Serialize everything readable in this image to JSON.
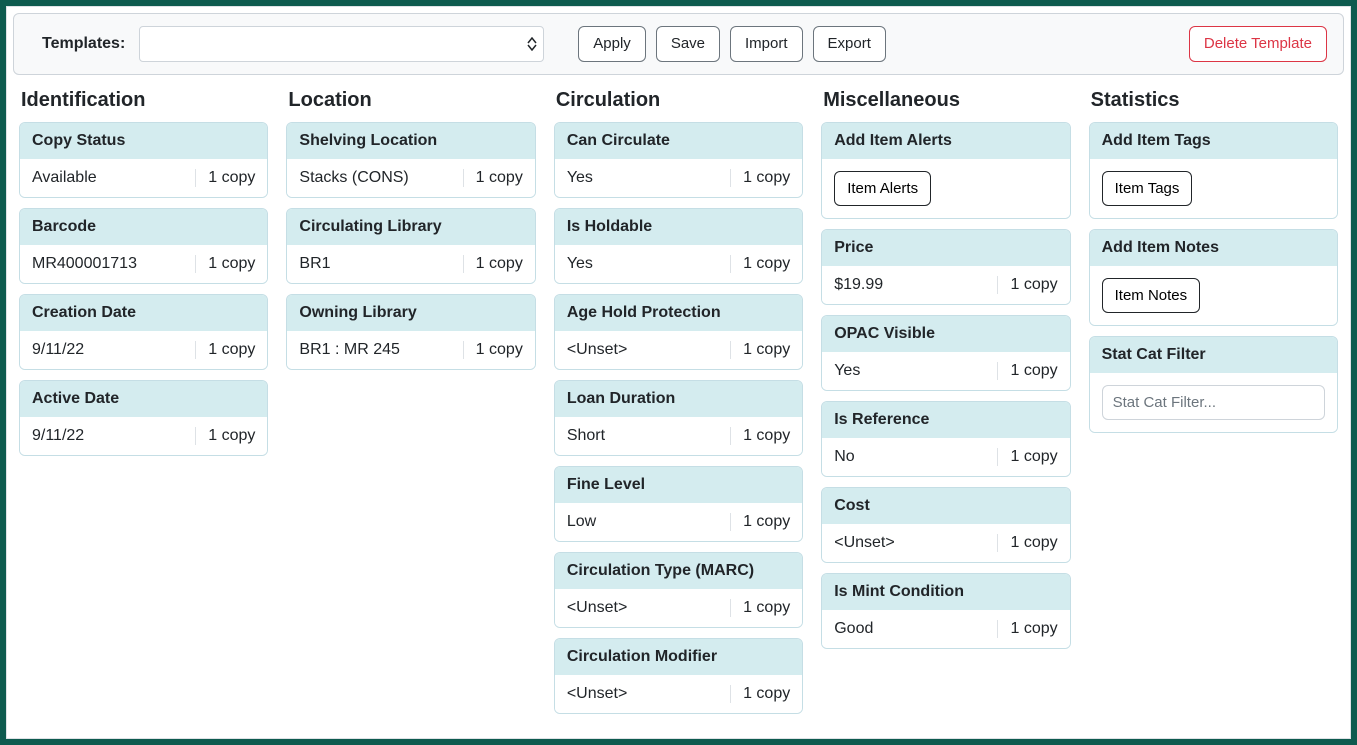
{
  "toolbar": {
    "templates_label": "Templates:",
    "apply": "Apply",
    "save": "Save",
    "import": "Import",
    "export": "Export",
    "delete_template": "Delete Template"
  },
  "columns": {
    "identification": {
      "title": "Identification",
      "fields": [
        {
          "label": "Copy Status",
          "value": "Available",
          "count": "1 copy"
        },
        {
          "label": "Barcode",
          "value": "MR400001713",
          "count": "1 copy"
        },
        {
          "label": "Creation Date",
          "value": "9/11/22",
          "count": "1 copy"
        },
        {
          "label": "Active Date",
          "value": "9/11/22",
          "count": "1 copy"
        }
      ]
    },
    "location": {
      "title": "Location",
      "fields": [
        {
          "label": "Shelving Location",
          "value": "Stacks (CONS)",
          "count": "1 copy"
        },
        {
          "label": "Circulating Library",
          "value": "BR1",
          "count": "1 copy"
        },
        {
          "label": "Owning Library",
          "value": "BR1 : MR 245",
          "count": "1 copy"
        }
      ]
    },
    "circulation": {
      "title": "Circulation",
      "fields": [
        {
          "label": "Can Circulate",
          "value": "Yes",
          "count": "1 copy"
        },
        {
          "label": "Is Holdable",
          "value": "Yes",
          "count": "1 copy"
        },
        {
          "label": "Age Hold Protection",
          "value": "<Unset>",
          "count": "1 copy"
        },
        {
          "label": "Loan Duration",
          "value": "Short",
          "count": "1 copy"
        },
        {
          "label": "Fine Level",
          "value": "Low",
          "count": "1 copy"
        },
        {
          "label": "Circulation Type (MARC)",
          "value": "<Unset>",
          "count": "1 copy"
        },
        {
          "label": "Circulation Modifier",
          "value": "<Unset>",
          "count": "1 copy"
        }
      ]
    },
    "miscellaneous": {
      "title": "Miscellaneous",
      "alerts_header": "Add Item Alerts",
      "alerts_button": "Item Alerts",
      "fields": [
        {
          "label": "Price",
          "value": "$19.99",
          "count": "1 copy"
        },
        {
          "label": "OPAC Visible",
          "value": "Yes",
          "count": "1 copy"
        },
        {
          "label": "Is Reference",
          "value": "No",
          "count": "1 copy"
        },
        {
          "label": "Cost",
          "value": "<Unset>",
          "count": "1 copy"
        },
        {
          "label": "Is Mint Condition",
          "value": "Good",
          "count": "1 copy"
        }
      ]
    },
    "statistics": {
      "title": "Statistics",
      "tags_header": "Add Item Tags",
      "tags_button": "Item Tags",
      "notes_header": "Add Item Notes",
      "notes_button": "Item Notes",
      "filter_header": "Stat Cat Filter",
      "filter_placeholder": "Stat Cat Filter..."
    }
  }
}
